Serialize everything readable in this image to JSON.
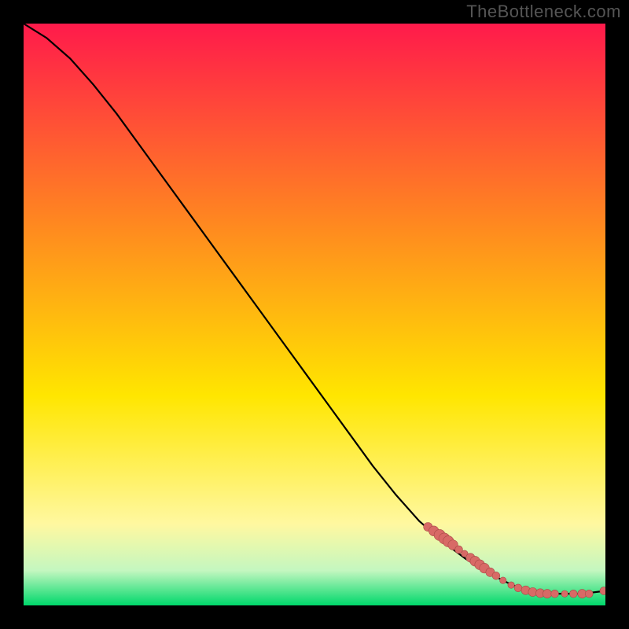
{
  "watermark": "TheBottleneck.com",
  "colors": {
    "frame": "#000000",
    "gradient_top": "#ff1a4b",
    "gradient_upper_mid": "#ff8a1f",
    "gradient_mid": "#ffe600",
    "gradient_lower_mid": "#fff8a0",
    "gradient_near_bottom": "#c4f7c0",
    "gradient_bottom": "#00d86b",
    "line": "#000000",
    "marker_fill": "#d86a66",
    "marker_stroke": "#a84a46"
  },
  "chart_data": {
    "type": "line",
    "title": "",
    "xlabel": "",
    "ylabel": "",
    "xlim": [
      0,
      100
    ],
    "ylim": [
      0,
      100
    ],
    "grid": false,
    "legend": null,
    "series": [
      {
        "name": "curve",
        "x": [
          0,
          4,
          8,
          12,
          16,
          20,
          24,
          28,
          32,
          36,
          40,
          44,
          48,
          52,
          56,
          60,
          64,
          68,
          72,
          76,
          80,
          84,
          86,
          88,
          92,
          96,
          100
        ],
        "y": [
          100,
          97.5,
          94,
          89.5,
          84.5,
          79,
          73.5,
          68,
          62.5,
          57,
          51.5,
          46,
          40.5,
          35,
          29.5,
          24,
          19,
          14.5,
          11,
          8,
          5.5,
          3.5,
          2.8,
          2.3,
          2.0,
          2.0,
          2.5
        ]
      }
    ],
    "markers": [
      {
        "x": 69.5,
        "y": 13.5,
        "r": 4
      },
      {
        "x": 70.5,
        "y": 12.8,
        "r": 4.5
      },
      {
        "x": 71.5,
        "y": 12.1,
        "r": 5
      },
      {
        "x": 72.3,
        "y": 11.5,
        "r": 5
      },
      {
        "x": 73.0,
        "y": 11.0,
        "r": 5
      },
      {
        "x": 73.8,
        "y": 10.4,
        "r": 4.5
      },
      {
        "x": 74.8,
        "y": 9.6,
        "r": 3.5
      },
      {
        "x": 75.8,
        "y": 8.9,
        "r": 3
      },
      {
        "x": 76.8,
        "y": 8.2,
        "r": 4
      },
      {
        "x": 77.6,
        "y": 7.6,
        "r": 4.5
      },
      {
        "x": 78.4,
        "y": 7.0,
        "r": 4.5
      },
      {
        "x": 79.2,
        "y": 6.4,
        "r": 4.5
      },
      {
        "x": 80.2,
        "y": 5.7,
        "r": 4
      },
      {
        "x": 81.2,
        "y": 5.1,
        "r": 3.5
      },
      {
        "x": 82.4,
        "y": 4.3,
        "r": 3
      },
      {
        "x": 83.8,
        "y": 3.5,
        "r": 3
      },
      {
        "x": 85.0,
        "y": 3.0,
        "r": 3.5
      },
      {
        "x": 86.3,
        "y": 2.6,
        "r": 4
      },
      {
        "x": 87.5,
        "y": 2.3,
        "r": 4
      },
      {
        "x": 88.8,
        "y": 2.1,
        "r": 4
      },
      {
        "x": 90.0,
        "y": 2.0,
        "r": 4
      },
      {
        "x": 91.3,
        "y": 2.0,
        "r": 3.5
      },
      {
        "x": 93.0,
        "y": 2.0,
        "r": 3
      },
      {
        "x": 94.5,
        "y": 2.0,
        "r": 3.5
      },
      {
        "x": 96.0,
        "y": 2.0,
        "r": 4
      },
      {
        "x": 97.2,
        "y": 2.0,
        "r": 3.5
      },
      {
        "x": 99.7,
        "y": 2.5,
        "r": 3.5
      }
    ]
  }
}
